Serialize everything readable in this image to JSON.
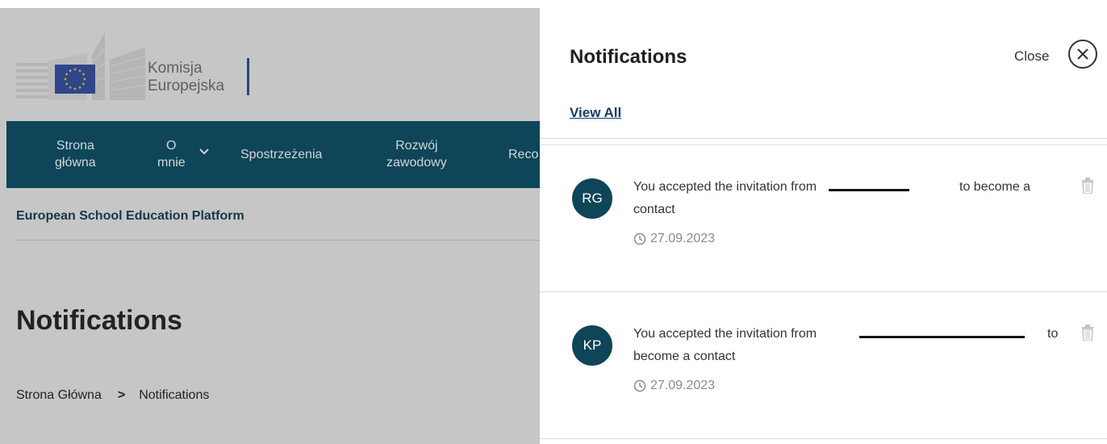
{
  "brand": {
    "line1": "Komisja",
    "line2": "Europejska"
  },
  "nav": {
    "item1_line1": "Strona",
    "item1_line2": "główna",
    "item2_line1": "O",
    "item2_line2": "mnie",
    "item3": "Spostrzeżenia",
    "item4_line1": "Rozwój",
    "item4_line2": "zawodowy",
    "item5": "Reco"
  },
  "site_title": "European School Education Platform",
  "page_heading": "Notifications",
  "breadcrumb": {
    "home": "Strona Główna",
    "separator": ">",
    "current": "Notifications"
  },
  "panel": {
    "title": "Notifications",
    "close_label": "Close",
    "view_all": "View All",
    "notifications": [
      {
        "initials": "RG",
        "text_before": "You accepted the invitation from",
        "text_after": "to become a",
        "text_line2": "contact",
        "date": "27.09.2023"
      },
      {
        "initials": "KP",
        "text_before": "You accepted the invitation from",
        "text_after": "to",
        "text_line2": "become a contact",
        "date": "27.09.2023"
      }
    ]
  },
  "colors": {
    "navbar": "#0f4558",
    "avatar": "#0f4558",
    "link": "#173b66",
    "overlay": "#c6c6c6"
  },
  "icons": [
    "eu-flag-icon",
    "chevron-down-icon",
    "breadcrumb-chevron-icon",
    "close-icon",
    "clock-icon",
    "trash-icon"
  ]
}
